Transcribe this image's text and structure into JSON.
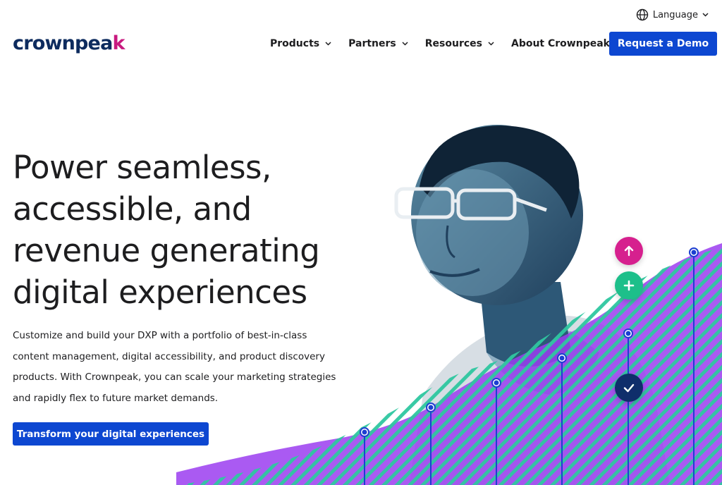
{
  "utility": {
    "language_label": "Language"
  },
  "brand": {
    "logo_main": "crownpea",
    "logo_accent": "k"
  },
  "nav": {
    "items": [
      {
        "label": "Products"
      },
      {
        "label": "Partners"
      },
      {
        "label": "Resources"
      },
      {
        "label": "About Crownpeak"
      }
    ],
    "cta_label": "Request a Demo"
  },
  "hero": {
    "title_lines": [
      "Power seamless,",
      "accessible, and",
      "revenue generating",
      "digital experiences"
    ],
    "description": "Customize and build your DXP with a portfolio of best-in-class content management, digital accessibility, and product discovery products. With Crownpeak, you can scale your marketing strategies and rapidly flex to future market demands.",
    "cta_label": "Transform your digital experiences"
  },
  "colors": {
    "brand_navy": "#0d2b5e",
    "brand_magenta": "#c8197f",
    "primary_blue": "#0d47d1",
    "badge_pink": "#d6208e",
    "badge_green": "#1dbf8a",
    "badge_navy": "#0f2e6b",
    "wave_purple": "#9b3df0",
    "wave_green": "#2fc7a0"
  },
  "icons": {
    "language": "globe-icon",
    "dropdown": "chevron-down-icon",
    "badges": [
      "arrow-up-icon",
      "plus-icon",
      "check-icon"
    ]
  }
}
